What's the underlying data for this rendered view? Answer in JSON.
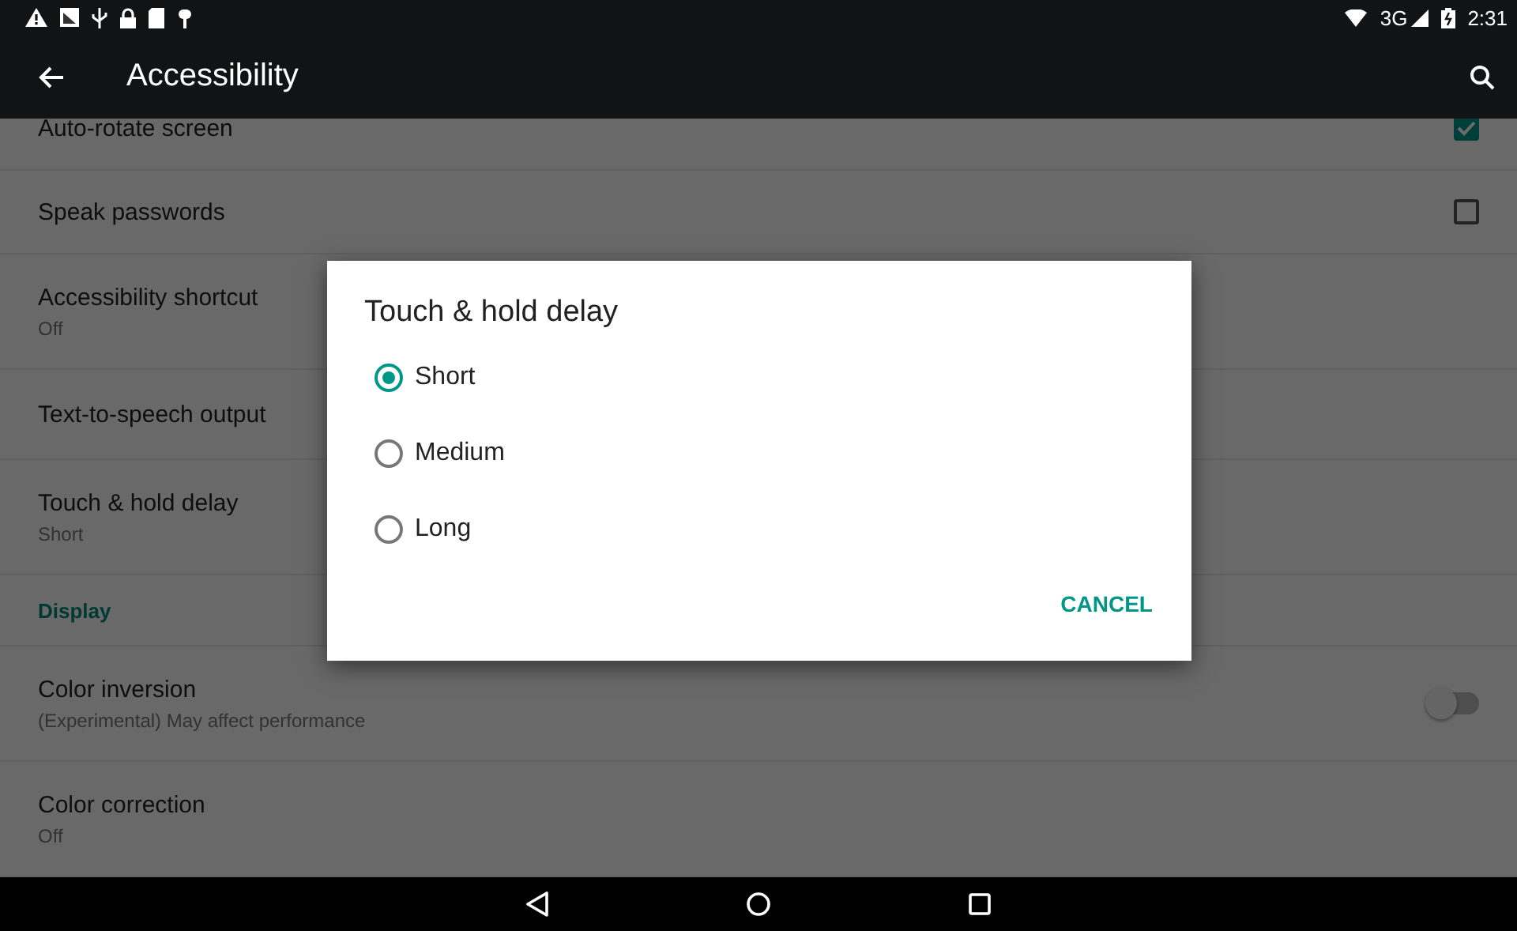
{
  "status_bar": {
    "network": "3G",
    "time": "2:31"
  },
  "app_bar": {
    "title": "Accessibility"
  },
  "settings": [
    {
      "kind": "checkbox",
      "title": "Auto-rotate screen",
      "checked": true
    },
    {
      "kind": "checkbox",
      "title": "Speak passwords",
      "checked": false
    },
    {
      "kind": "plain",
      "title": "Accessibility shortcut",
      "summary": "Off"
    },
    {
      "kind": "plain",
      "title": "Text-to-speech output"
    },
    {
      "kind": "plain",
      "title": "Touch & hold delay",
      "summary": "Short"
    },
    {
      "kind": "header",
      "title": "Display"
    },
    {
      "kind": "switch",
      "title": "Color inversion",
      "summary": "(Experimental) May affect performance",
      "on": false
    },
    {
      "kind": "plain",
      "title": "Color correction",
      "summary": "Off"
    }
  ],
  "dialog": {
    "title": "Touch & hold delay",
    "options": [
      {
        "label": "Short",
        "selected": true
      },
      {
        "label": "Medium",
        "selected": false
      },
      {
        "label": "Long",
        "selected": false
      }
    ],
    "buttons": [
      "CANCEL"
    ]
  }
}
